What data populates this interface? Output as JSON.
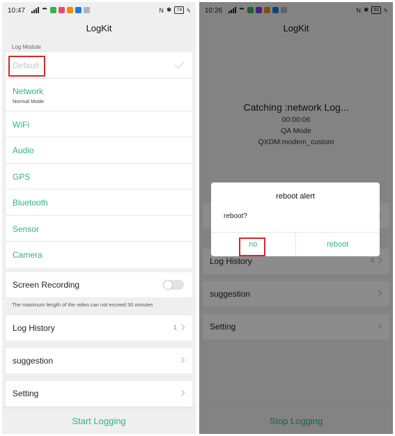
{
  "left": {
    "status": {
      "time": "10:47",
      "battery": "74"
    },
    "title": "LogKit",
    "section_label": "Log Module",
    "modules": [
      {
        "label": "Default",
        "state": "selected"
      },
      {
        "label": "Network",
        "sub": "Normal Mode"
      },
      {
        "label": "WiFi"
      },
      {
        "label": "Audio"
      },
      {
        "label": "GPS"
      },
      {
        "label": "Bluetooth"
      },
      {
        "label": "Sensor"
      },
      {
        "label": "Camera"
      }
    ],
    "screen_recording": {
      "label": "Screen Recording",
      "enabled": false
    },
    "note": "The maximum length of the video can not exceed 30 minutes",
    "log_history": {
      "label": "Log History",
      "count": "1"
    },
    "suggestion": "suggestion",
    "setting": "Setting",
    "start_button": "Start Logging"
  },
  "right": {
    "status": {
      "time": "10:26",
      "battery": "60"
    },
    "title": "LogKit",
    "catching_title": "Catching :network Log...",
    "elapsed": "00:00:06",
    "mode": "QA Mode",
    "qxdm": "QXDM:modem_custom",
    "log_history": {
      "label": "Log History",
      "count": "0"
    },
    "suggestion": "suggestion",
    "setting": "Setting",
    "stop_button": "Stop Logging",
    "dialog": {
      "title": "reboot alert",
      "message": "reboot?",
      "no": "no",
      "reboot": "reboot"
    }
  },
  "colors": {
    "accent": "#2bb585",
    "highlight_box": "#d62728",
    "disabled": "#c7c7c7"
  }
}
